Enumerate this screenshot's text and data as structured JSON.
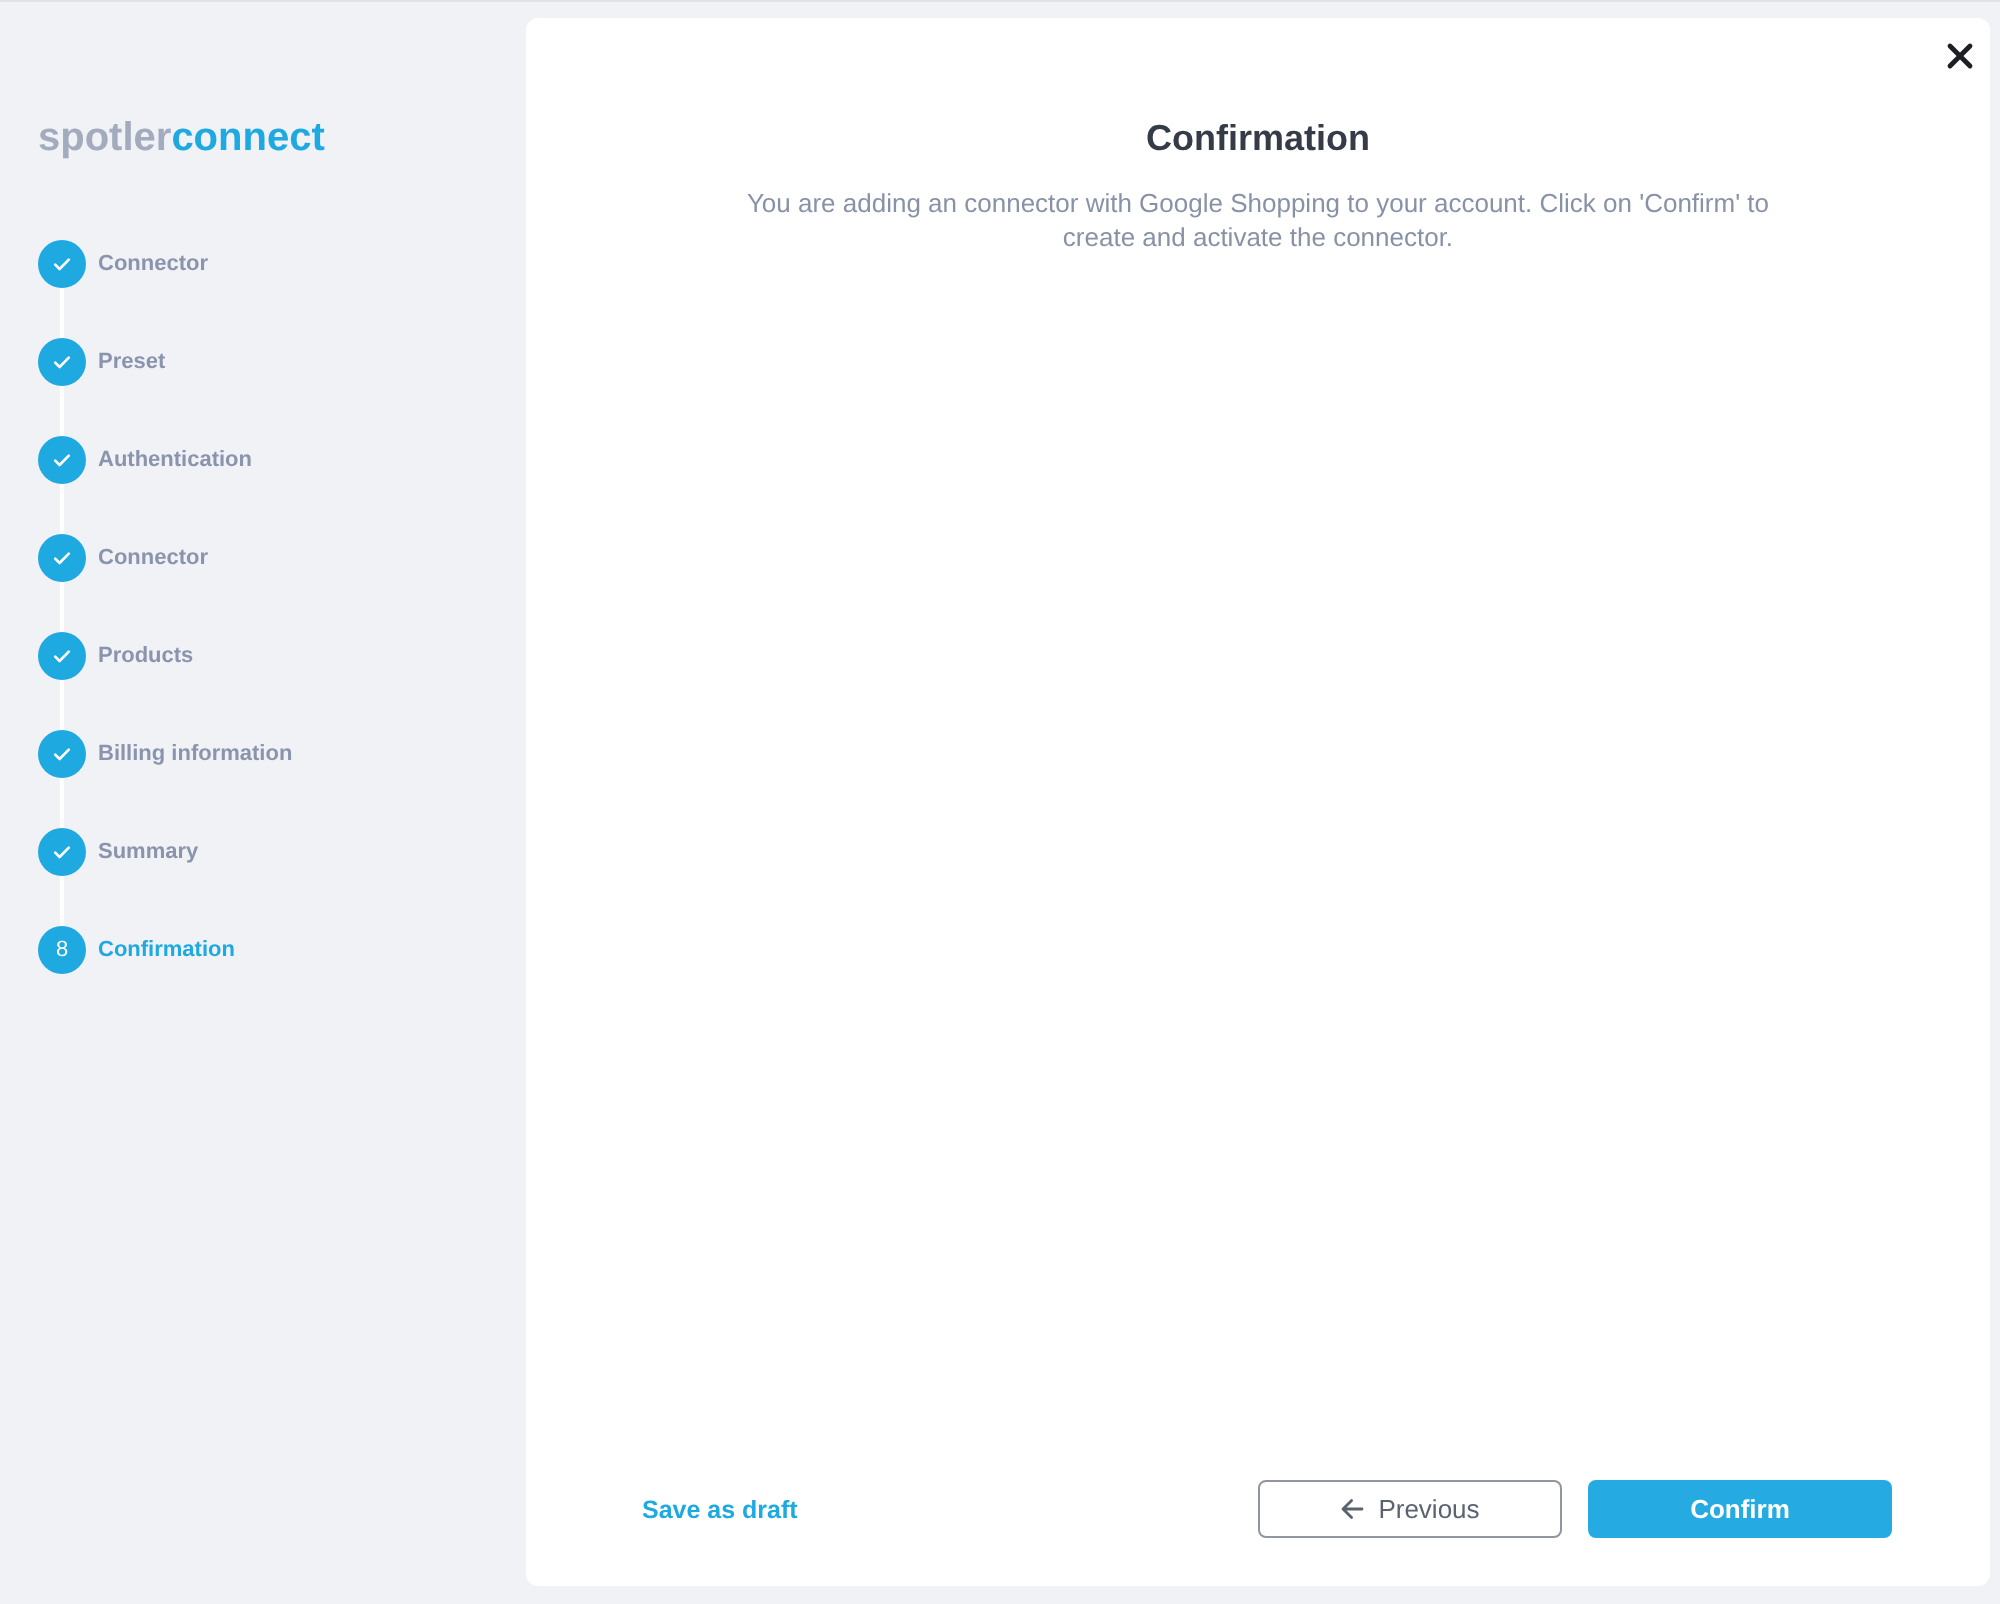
{
  "logo": {
    "part_1": "spotler",
    "part_2": "connect"
  },
  "steps": [
    {
      "label": "Connector",
      "completed": true,
      "selected": false
    },
    {
      "label": "Preset",
      "completed": true,
      "selected": false
    },
    {
      "label": "Authentication",
      "completed": true,
      "selected": false
    },
    {
      "label": "Connector",
      "completed": true,
      "selected": false
    },
    {
      "label": "Products",
      "completed": true,
      "selected": false
    },
    {
      "label": "Billing information",
      "completed": true,
      "selected": false
    },
    {
      "label": "Summary",
      "completed": true,
      "selected": false
    },
    {
      "label": "Confirmation",
      "number": "8",
      "completed": false,
      "selected": true
    }
  ],
  "dialog": {
    "title": "Confirmation",
    "description": "You are adding an connector with Google Shopping to your account. Click on 'Confirm' to create and activate the connector."
  },
  "footer": {
    "save_draft": "Save as draft",
    "previous": "Previous",
    "confirm": "Confirm"
  }
}
